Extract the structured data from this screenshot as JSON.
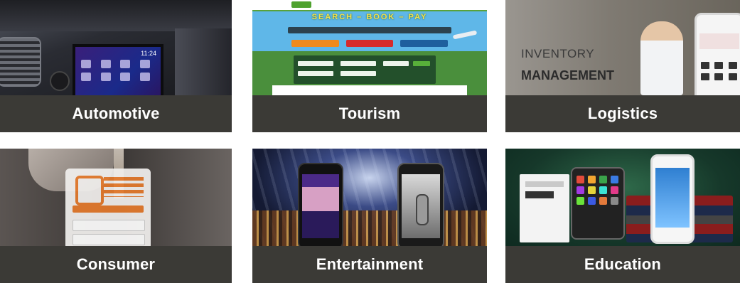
{
  "tiles": [
    {
      "id": "automotive",
      "label": "Automotive"
    },
    {
      "id": "tourism",
      "label": "Tourism"
    },
    {
      "id": "logistics",
      "label": "Logistics"
    },
    {
      "id": "consumer",
      "label": "Consumer"
    },
    {
      "id": "entertainment",
      "label": "Entertainment"
    },
    {
      "id": "education",
      "label": "Education"
    }
  ],
  "automotive_image": {
    "clock": "11:24"
  },
  "tourism_image": {
    "headline": "SEARCH – BOOK – PAY"
  },
  "logistics_image": {
    "line1": "INVENTORY",
    "line2": "MANAGEMENT"
  },
  "colors": {
    "caption_bar": "#3b3a36",
    "caption_text": "#ffffff"
  }
}
